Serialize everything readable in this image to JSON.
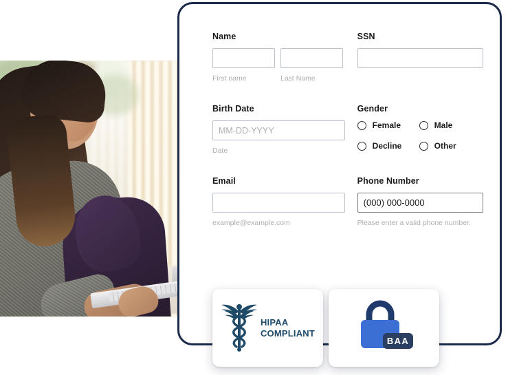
{
  "form": {
    "fields": {
      "name": {
        "label": "Name",
        "first": {
          "value": "",
          "placeholder": "",
          "hint": "First name"
        },
        "last": {
          "value": "",
          "placeholder": "",
          "hint": "Last Name"
        }
      },
      "ssn": {
        "label": "SSN",
        "value": "",
        "placeholder": ""
      },
      "birth_date": {
        "label": "Birth Date",
        "value": "",
        "placeholder": "MM-DD-YYYY",
        "hint": "Date"
      },
      "gender": {
        "label": "Gender",
        "options": [
          {
            "label": "Female",
            "selected": false
          },
          {
            "label": "Male",
            "selected": false
          },
          {
            "label": "Decline",
            "selected": false
          },
          {
            "label": "Other",
            "selected": false
          }
        ]
      },
      "email": {
        "label": "Email",
        "value": "",
        "placeholder": "",
        "hint": "example@example.com"
      },
      "phone": {
        "label": "Phone Number",
        "value": "(000) 000-0000",
        "placeholder": "(000) 000-0000",
        "hint": "Please enter a valid phone number."
      }
    }
  },
  "badges": [
    {
      "id": "hipaa",
      "icon": "caduceus-icon",
      "line1": "HIPAA",
      "line2": "COMPLIANT",
      "color": "#1f4a68"
    },
    {
      "id": "baa",
      "icon": "lock-icon",
      "tag": "BAA",
      "lock_body_color": "#3b6fd4",
      "lock_shackle_color": "#1f3a6b",
      "tag_color": "#2b3f63"
    }
  ],
  "photo": {
    "alt": "Woman sitting on a bed using a laptop near a window"
  },
  "theme": {
    "card_border": "#1b2a4a",
    "input_border": "#b9c0ca",
    "input_border_active": "#7a7a7a",
    "label_color": "#1b1b1b",
    "hint_color": "#aeaeae",
    "page_background": "#ffffff"
  }
}
